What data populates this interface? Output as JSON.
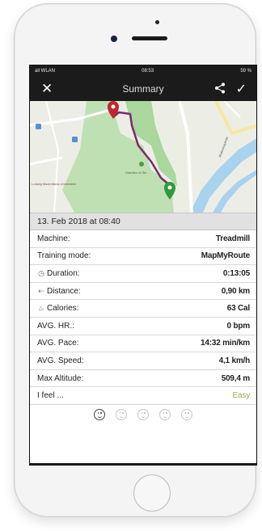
{
  "status": {
    "carrier": "all WLAN",
    "time": "08:53",
    "battery": "59 %"
  },
  "nav": {
    "close": "✕",
    "title": "Summary",
    "confirm": "✓"
  },
  "map": {
    "label_park": "Giardino di Ste...",
    "label_left": "Ludwig Maximilians Universitat",
    "label_road": "Widenmayerstr."
  },
  "session": {
    "date": "13. Feb 2018 at 08:40"
  },
  "rows": [
    {
      "label": "Machine:",
      "value": "Treadmill",
      "icon": ""
    },
    {
      "label": "Training mode:",
      "value": "MapMyRoute",
      "icon": ""
    },
    {
      "label": "Duration:",
      "value": "0:13:05",
      "icon": "clock-icon"
    },
    {
      "label": "Distance:",
      "value": "0,90 km",
      "icon": "distance-icon"
    },
    {
      "label": "Calories:",
      "value": "63 Cal",
      "icon": "flame-icon"
    },
    {
      "label": "AVG. HR.:",
      "value": "0 bpm",
      "icon": ""
    },
    {
      "label": "AVG. Pace:",
      "value": "14:32 min/km",
      "icon": ""
    },
    {
      "label": "AVG. Speed:",
      "value": "4,1 km/h",
      "icon": ""
    },
    {
      "label": "Max Altitude:",
      "value": "509,4 m",
      "icon": ""
    },
    {
      "label": "I feel ...",
      "value": "Easy",
      "icon": ""
    }
  ],
  "feel_selected_index": 0,
  "colors": {
    "route": "#7a2a6d",
    "start_pin": "#c0262f",
    "end_pin": "#2e9a3f",
    "easy": "#a8a550"
  }
}
